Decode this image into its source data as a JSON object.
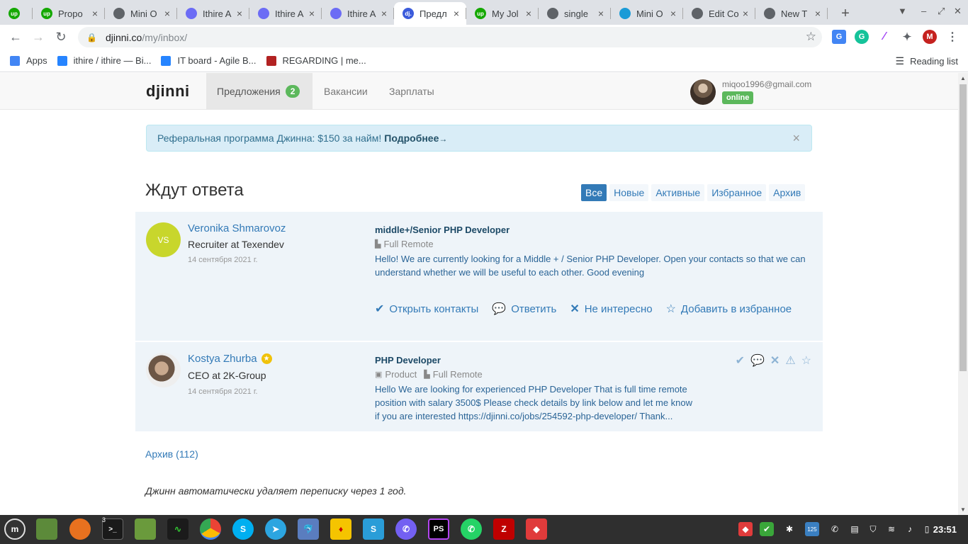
{
  "browser": {
    "tabs": [
      {
        "title": "",
        "favicon_color": "#14a800",
        "favicon_text": "up"
      },
      {
        "title": "Propo",
        "favicon_color": "#14a800",
        "favicon_text": "up"
      },
      {
        "title": "Mini O",
        "favicon_color": "#5f6368",
        "favicon_text": ""
      },
      {
        "title": "Ithire A",
        "favicon_color": "#6c6cf5",
        "favicon_text": ""
      },
      {
        "title": "Ithire A",
        "favicon_color": "#6c6cf5",
        "favicon_text": ""
      },
      {
        "title": "Ithire A",
        "favicon_color": "#6c6cf5",
        "favicon_text": ""
      },
      {
        "title": "Предл",
        "favicon_color": "#3b5bdb",
        "favicon_text": "dj."
      },
      {
        "title": "My Jol",
        "favicon_color": "#14a800",
        "favicon_text": "up"
      },
      {
        "title": "single",
        "favicon_color": "#5f6368",
        "favicon_text": ""
      },
      {
        "title": "Mini O",
        "favicon_color": "#1a9bd7",
        "favicon_text": ""
      },
      {
        "title": "Edit Co",
        "favicon_color": "#5f6368",
        "favicon_text": ""
      },
      {
        "title": "New T",
        "favicon_color": "#5f6368",
        "favicon_text": ""
      }
    ],
    "active_tab_index": 6,
    "url_host": "djinni.co",
    "url_path": "/my/inbox/",
    "bookmarks": [
      {
        "label": "Apps",
        "icon": "apps-grid-icon",
        "color": "#4285f4"
      },
      {
        "label": "ithire / ithire — Bi...",
        "icon": "bitbucket-icon",
        "color": "#2684ff"
      },
      {
        "label": "IT board - Agile B...",
        "icon": "jira-icon",
        "color": "#2684ff"
      },
      {
        "label": "REGARDING | me...",
        "icon": "crest-icon",
        "color": "#b22222"
      }
    ],
    "reading_list": "Reading list",
    "profile_initial": "M"
  },
  "site": {
    "logo": "djinni",
    "nav": [
      {
        "label": "Предложения",
        "badge": "2",
        "active": true
      },
      {
        "label": "Вакансии"
      },
      {
        "label": "Зарплаты"
      }
    ],
    "user_email": "miqoo1996@gmail.com",
    "user_status": "online"
  },
  "alert": {
    "text": "Реферальная программа Джинна: $150 за найм!",
    "link": "Подробнее",
    "arrow": "→",
    "close": "×"
  },
  "inbox": {
    "title": "Ждут ответа",
    "filters": [
      {
        "label": "Все",
        "active": true
      },
      {
        "label": "Новые"
      },
      {
        "label": "Активные"
      },
      {
        "label": "Избранное"
      },
      {
        "label": "Архив"
      }
    ],
    "messages": [
      {
        "initials": "VS",
        "avatar_color": "#c8d62c",
        "name": "Veronika Shmarovoz",
        "role": "Recruiter at Texendev",
        "date": "14 сентября 2021 г.",
        "job": "middle+/Senior PHP Developer",
        "tags": [
          "Full Remote"
        ],
        "text_lines": [
          "Hello! We are currently looking for a Middle + / Senior PHP Developer. Open your contacts so that we can",
          "understand whether we will be useful to each other. Good evening"
        ],
        "actions": [
          "Открыть контакты",
          "Ответить",
          "Не интересно",
          "Добавить в избранное"
        ]
      },
      {
        "initials": "",
        "avatar_color": "#7a6a5c",
        "name": "Kostya Zhurba",
        "verified": true,
        "role": "CEO at 2K-Group",
        "date": "14 сентября 2021 г.",
        "job": "PHP Developer",
        "tags": [
          "Product",
          "Full Remote"
        ],
        "text_lines": [
          "Hello We are looking for experienced PHP Developer That is full time remote",
          "position with salary 3500$ Please check details by link below and let me know",
          "if you are interested https://djinni.co/jobs/254592-php-developer/ Thank..."
        ]
      }
    ],
    "archive_link": "Архив (112)",
    "footer_note": "Джинн автоматически удаляет переписку через 1 год."
  },
  "taskbar": {
    "clock": "23:51",
    "terminal_badge": "3",
    "tray_badge": "125"
  }
}
